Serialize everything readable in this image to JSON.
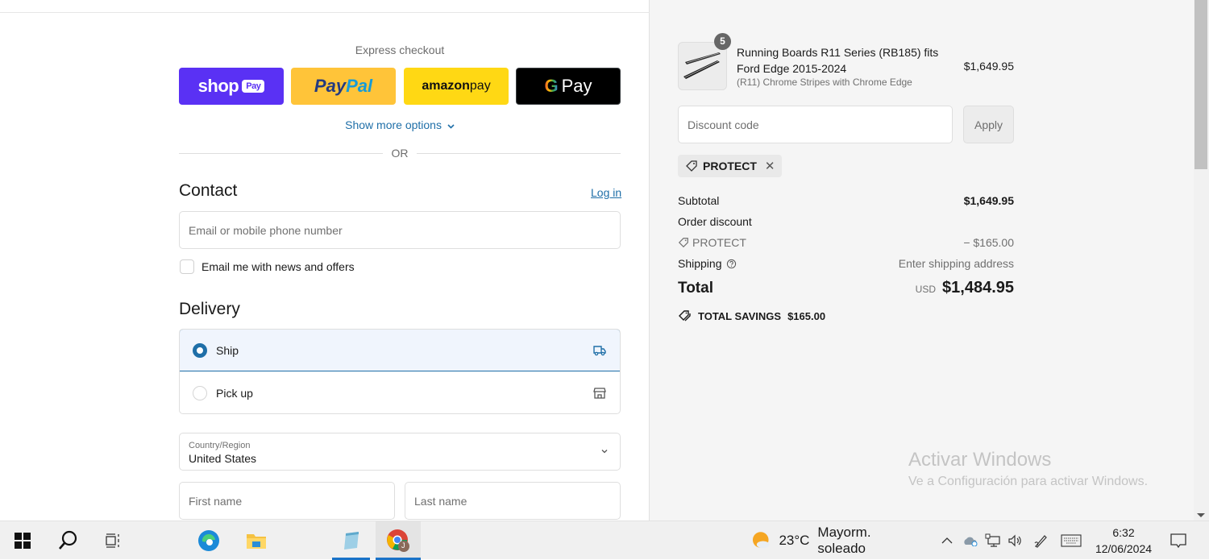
{
  "express": {
    "label": "Express checkout",
    "buttons": [
      {
        "name": "Shop Pay",
        "word": "shop",
        "pill": "Pay",
        "color": "#5a31f4"
      },
      {
        "name": "PayPal",
        "part1": "Pay",
        "part2": "Pal",
        "color": "#ffc439"
      },
      {
        "name": "Amazon Pay",
        "part1": "amazon",
        "part2": " pay",
        "color": "#ffd814"
      },
      {
        "name": "Google Pay",
        "g": "G",
        "word": "Pay",
        "color": "#000000"
      }
    ],
    "show_more": "Show more options",
    "or": "OR"
  },
  "contact": {
    "title": "Contact",
    "login": "Log in",
    "email_placeholder": "Email or mobile phone number",
    "newsletter_label": "Email me with news and offers",
    "newsletter_checked": false
  },
  "delivery": {
    "title": "Delivery",
    "options": [
      {
        "label": "Ship",
        "selected": true,
        "icon": "truck-icon"
      },
      {
        "label": "Pick up",
        "selected": false,
        "icon": "store-icon"
      }
    ],
    "country_label": "Country/Region",
    "country_value": "United States",
    "first_name_placeholder": "First name",
    "last_name_placeholder": "Last name"
  },
  "summary": {
    "item": {
      "quantity": "5",
      "name": "Running Boards R11 Series (RB185) fits Ford Edge 2015-2024",
      "variant": "(R11) Chrome Stripes with Chrome Edge",
      "price": "$1,649.95"
    },
    "discount_placeholder": "Discount code",
    "apply_label": "Apply",
    "applied_code": "PROTECT",
    "rows": {
      "subtotal_label": "Subtotal",
      "subtotal_value": "$1,649.95",
      "order_discount_label": "Order discount",
      "discount_code": "PROTECT",
      "discount_value": "− $165.00",
      "shipping_label": "Shipping",
      "shipping_value": "Enter shipping address",
      "total_label": "Total",
      "currency": "USD",
      "total_value": "$1,484.95"
    },
    "savings_label": "TOTAL SAVINGS",
    "savings_value": "$165.00"
  },
  "watermark": {
    "title": "Activar Windows",
    "subtitle": "Ve a Configuración para activar Windows."
  },
  "taskbar": {
    "weather_temp": "23°C",
    "weather_desc": "Mayorm. soleado",
    "time": "6:32",
    "date": "12/06/2024",
    "chrome_profile_initial": "J"
  },
  "colors": {
    "accent": "#1f6fa8",
    "summary_bg": "#f5f5f5"
  }
}
